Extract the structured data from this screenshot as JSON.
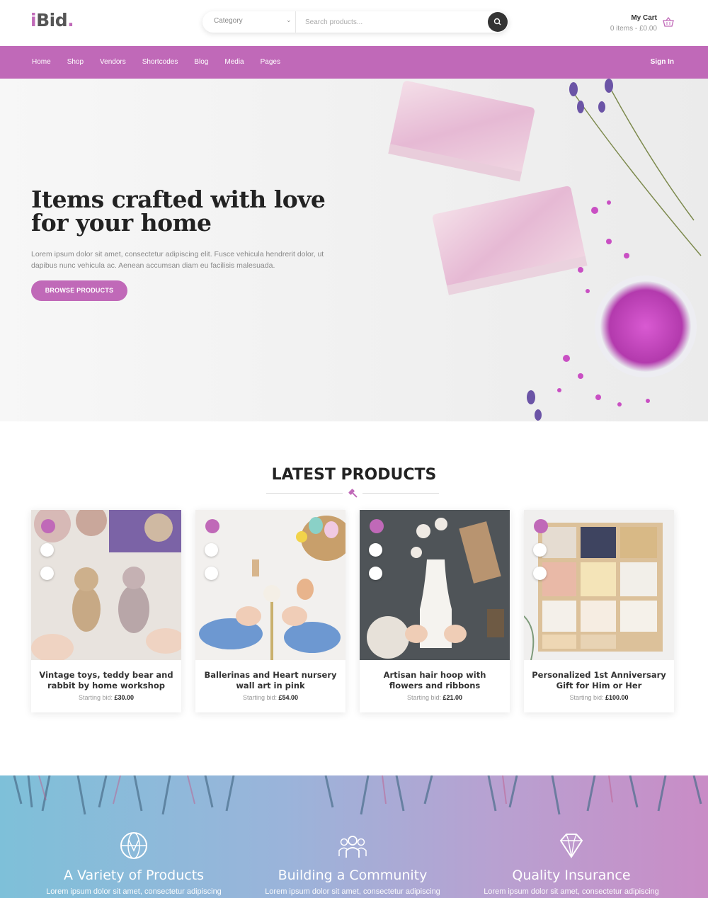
{
  "brand": {
    "logo_text": "iBid",
    "accent_color": "#c069b8"
  },
  "search": {
    "category_label": "Category",
    "placeholder": "Search products..."
  },
  "cart": {
    "title": "My Cart",
    "summary": "0 items - £0.00"
  },
  "nav": {
    "items": [
      "Home",
      "Shop",
      "Vendors",
      "Shortcodes",
      "Blog",
      "Media",
      "Pages"
    ],
    "sign_in": "Sign In"
  },
  "hero": {
    "title_line1": "Items crafted with love",
    "title_line2": "for your home",
    "text": "Lorem ipsum dolor sit amet, consectetur adipiscing elit. Fusce vehicula hendrerit dolor, ut dapibus nunc vehicula ac. Aenean accumsan diam eu facilisis malesuada.",
    "button": "BROWSE PRODUCTS"
  },
  "latest": {
    "title": "LATEST PRODUCTS",
    "bid_label": "Starting bid:",
    "products": [
      {
        "name": "Vintage toys, teddy bear and rabbit by home workshop",
        "price": "£30.00"
      },
      {
        "name": "Ballerinas and Heart nursery wall art in pink",
        "price": "£54.00"
      },
      {
        "name": "Artisan hair hoop with flowers and ribbons",
        "price": "£21.00"
      },
      {
        "name": "Personalized 1st Anniversary Gift for Him or Her",
        "price": "£100.00"
      }
    ]
  },
  "features": [
    {
      "title": "A Variety of Products",
      "text": "Lorem ipsum dolor sit amet, consectetur adipiscing",
      "icon": "globe-icon"
    },
    {
      "title": "Building a Community",
      "text": "Lorem ipsum dolor sit amet, consectetur adipiscing",
      "icon": "community-icon"
    },
    {
      "title": "Quality Insurance",
      "text": "Lorem ipsum dolor sit amet, consectetur adipiscing",
      "icon": "diamond-icon"
    }
  ]
}
